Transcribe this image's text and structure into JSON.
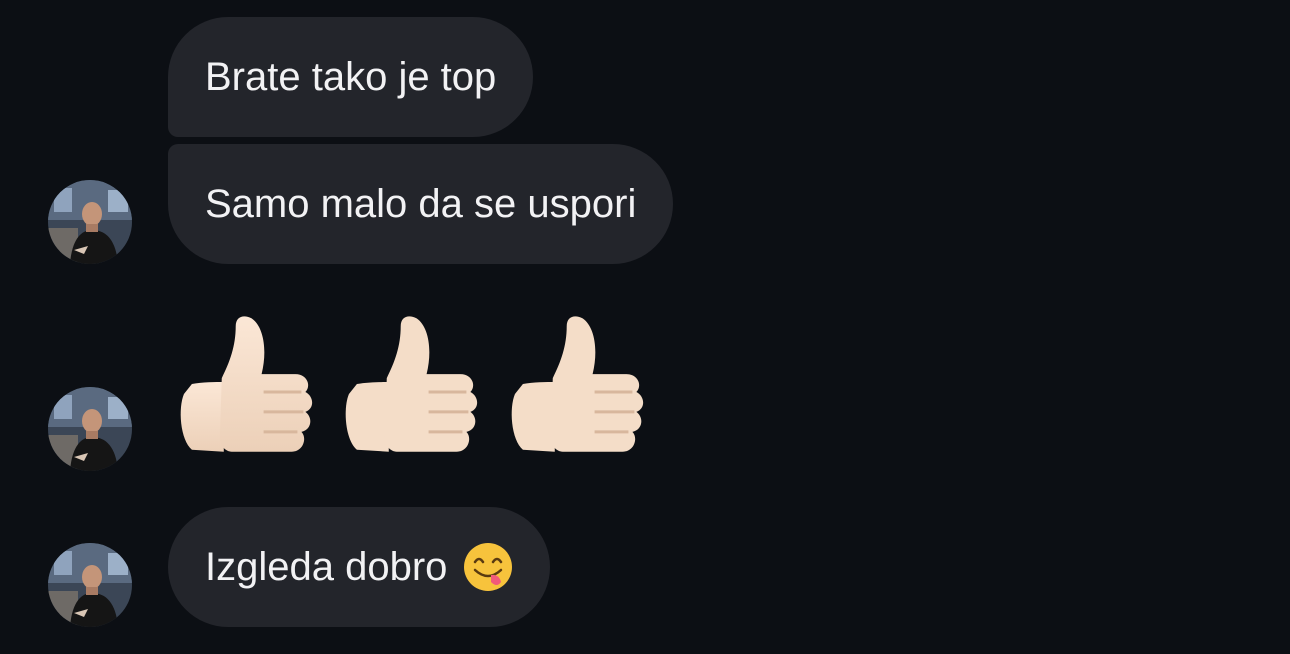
{
  "messages": [
    {
      "type": "text",
      "text": "Brate tako je top",
      "avatar": false
    },
    {
      "type": "text",
      "text": "Samo malo da se uspori",
      "avatar": true
    },
    {
      "type": "emoji",
      "emoji": [
        "thumbs-up-icon",
        "thumbs-up-icon",
        "thumbs-up-icon"
      ],
      "avatar": true
    },
    {
      "type": "text",
      "text": "Izgleda dobro",
      "emoji": "face-savoring-food-icon",
      "avatar": true
    }
  ],
  "colors": {
    "background": "#0c0f14",
    "bubble": "#23252b",
    "text": "#f2f2f4"
  }
}
